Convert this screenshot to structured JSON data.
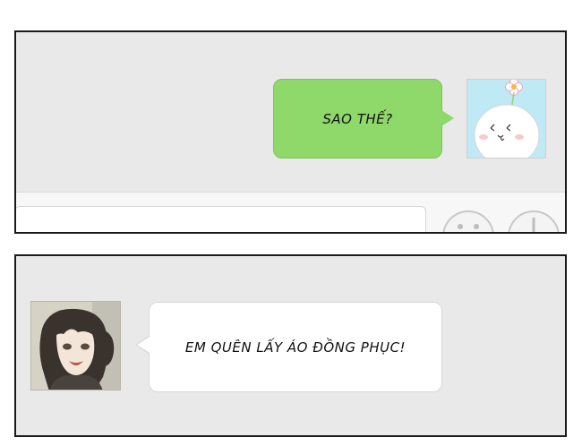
{
  "panels": [
    {
      "message": {
        "text": "SAO THẾ?",
        "side": "right",
        "bubble_color": "#8fd86a"
      },
      "avatar": "white-blob-with-flower-avatar",
      "input_bar": {
        "buttons": [
          "emoji-icon",
          "plus-icon"
        ]
      }
    },
    {
      "message": {
        "text": "EM QUÊN LẤY ÁO ĐỒNG PHỤC!",
        "side": "left",
        "bubble_color": "#ffffff"
      },
      "avatar": "dark-haired-girl-avatar"
    }
  ]
}
